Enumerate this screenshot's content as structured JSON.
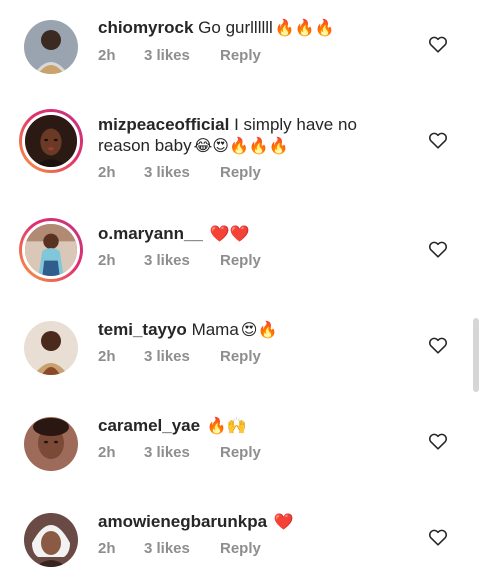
{
  "comments": [
    {
      "username": "chiomyrock",
      "text": "Go gurllllll",
      "emoji": "🔥🔥🔥",
      "time": "2h",
      "likes": "3 likes",
      "reply": "Reply"
    },
    {
      "username": "mizpeaceofficial",
      "text": "I simply have no reason baby",
      "emoji": "😂😍🔥🔥🔥",
      "time": "2h",
      "likes": "3 likes",
      "reply": "Reply"
    },
    {
      "username": "o.maryann__",
      "text": "",
      "emoji": "❤️❤️",
      "time": "2h",
      "likes": "3 likes",
      "reply": "Reply"
    },
    {
      "username": "temi_tayyo",
      "text": "Mama",
      "emoji": "😍🔥",
      "time": "2h",
      "likes": "3 likes",
      "reply": "Reply"
    },
    {
      "username": "caramel_yae",
      "text": "",
      "emoji": "🔥🙌",
      "time": "2h",
      "likes": "3 likes",
      "reply": "Reply"
    },
    {
      "username": "amowienegbarunkpa",
      "text": "",
      "emoji": "❤️",
      "time": "2h",
      "likes": "3 likes",
      "reply": "Reply"
    }
  ],
  "colors": {
    "primary_text": "#262626",
    "secondary_text": "#8e8e8e",
    "story_ring_start": "#f9a03f",
    "story_ring_end": "#c13584",
    "emoji_red": "#e0245e",
    "emoji_fire": "#ff6a00"
  },
  "icons": {
    "like": "heart-outline-icon",
    "avatar": "profile-photo"
  }
}
